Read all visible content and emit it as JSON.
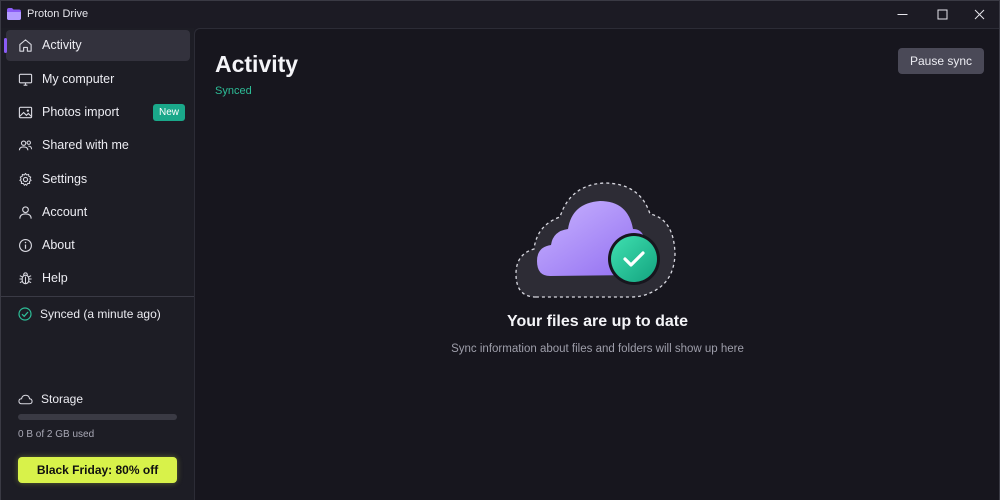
{
  "window": {
    "title": "Proton Drive",
    "brand_color": "#8b5cf6"
  },
  "sidebar": {
    "items": [
      {
        "label": "Activity",
        "icon": "home-icon",
        "active": true
      },
      {
        "label": "My computer",
        "icon": "monitor-icon"
      },
      {
        "label": "Photos import",
        "icon": "image-icon",
        "badge": "New"
      },
      {
        "label": "Shared with me",
        "icon": "users-icon"
      },
      {
        "label": "Settings",
        "icon": "gear-icon"
      },
      {
        "label": "Account",
        "icon": "user-icon"
      },
      {
        "label": "About",
        "icon": "info-icon"
      },
      {
        "label": "Help",
        "icon": "bug-icon"
      }
    ],
    "sync_status": "Synced (a minute ago)",
    "storage": {
      "label": "Storage",
      "used_text": "0 B of 2 GB used",
      "used_fraction": 0
    },
    "promo_label": "Black Friday: 80% off"
  },
  "main": {
    "title": "Activity",
    "status": "Synced",
    "pause_button": "Pause sync",
    "empty_title": "Your files are up to date",
    "empty_subtitle": "Sync information about files and folders will show up here"
  },
  "colors": {
    "accent": "#8b5cf6",
    "success": "#2dbd97",
    "promo": "#d8f24a"
  }
}
